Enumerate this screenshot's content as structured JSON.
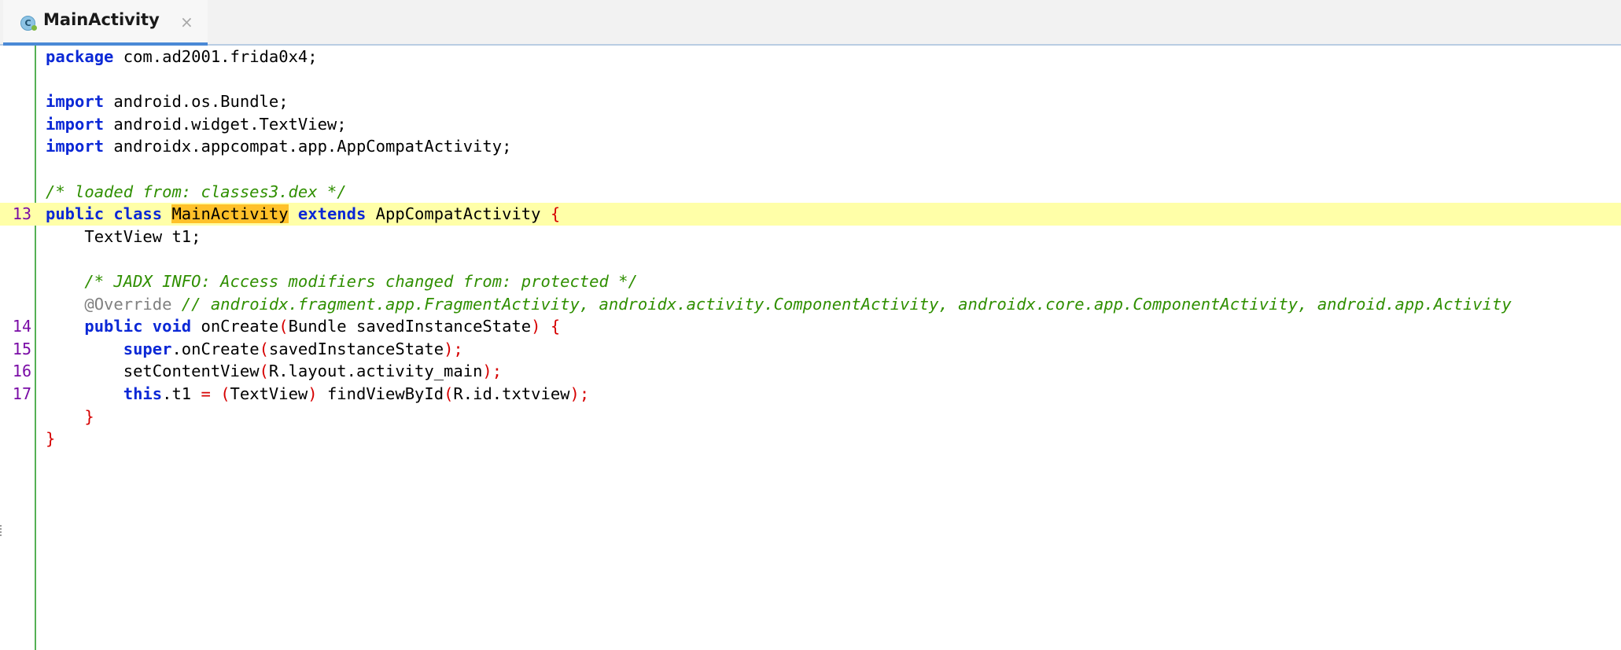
{
  "tab": {
    "icon_letter": "C",
    "title": "MainActivity",
    "close_glyph": "×"
  },
  "editor": {
    "lines": {
      "l01": {
        "num": "",
        "kw1": "package",
        "rest": " com.ad2001.frida0x4;"
      },
      "l03": {
        "num": "",
        "kw1": "import",
        "rest": " android.os.Bundle;"
      },
      "l04": {
        "num": "",
        "kw1": "import",
        "rest": " android.widget.TextView;"
      },
      "l05": {
        "num": "",
        "kw1": "import",
        "rest": " androidx.appcompat.app.AppCompatActivity;"
      },
      "l07": {
        "num": "",
        "comment": "/* loaded from: classes3.dex */"
      },
      "l08": {
        "num": "13",
        "kw1": "public",
        "kw2": "class",
        "classname": "MainActivity",
        "kw3": "extends",
        "superclass": "AppCompatActivity",
        "brace": "{"
      },
      "l09": {
        "num": "",
        "text": "    TextView t1;"
      },
      "l11": {
        "num": "",
        "comment": "    /* JADX INFO: Access modifiers changed from: protected */"
      },
      "l12": {
        "num": "",
        "annotation": "    @Override",
        "comment": " // androidx.fragment.app.FragmentActivity, androidx.activity.ComponentActivity, androidx.core.app.ComponentActivity, android.app.Activity"
      },
      "l13": {
        "num": "14",
        "kw1": "public",
        "kw2": "void",
        "method": " onCreate",
        "lp": "(",
        "params": "Bundle savedInstanceState",
        "rp": ")",
        "brace": "{"
      },
      "l14": {
        "num": "15",
        "kw1": "super",
        "call": ".onCreate",
        "lp": "(",
        "args": "savedInstanceState",
        "rp": ")",
        "semi": ";"
      },
      "l15": {
        "num": "16",
        "call": "setContentView",
        "lp": "(",
        "args": "R.layout.activity_main",
        "rp": ")",
        "semi": ";"
      },
      "l16": {
        "num": "17",
        "kw1": "this",
        "field": ".t1 ",
        "eq": "=",
        "lp1": "(",
        "cast": "TextView",
        "rp1": ")",
        "call": " findViewById",
        "lp2": "(",
        "args": "R.id.txtview",
        "rp2": ")",
        "semi": ";"
      },
      "l17": {
        "num": "",
        "brace": "}"
      },
      "l18": {
        "num": "",
        "brace": "}"
      }
    }
  },
  "colors": {
    "keyword": "#0b28d6",
    "comment": "#2f8f00",
    "punctuation": "#d60000",
    "line_number": "#7a0ca6",
    "current_line": "#ffffa8",
    "selection": "#ffc12a",
    "gutter_border": "#55b055"
  }
}
